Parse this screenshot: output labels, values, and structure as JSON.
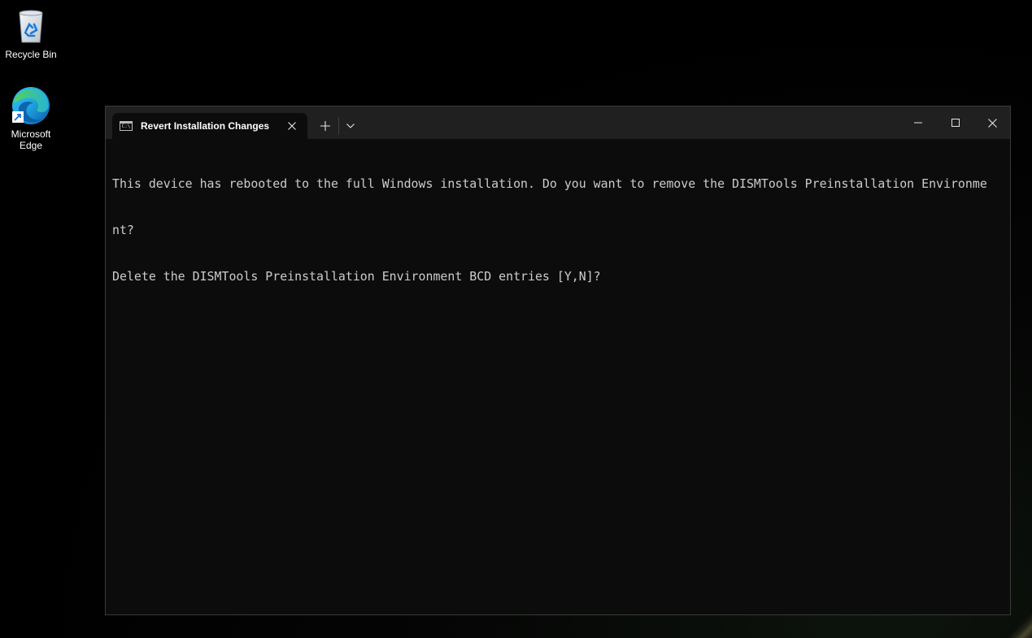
{
  "desktop": {
    "icons": [
      {
        "label": "Recycle Bin",
        "icon": "recycle-bin-icon"
      },
      {
        "label": "Microsoft\nEdge",
        "icon": "edge-icon"
      }
    ]
  },
  "window": {
    "tab": {
      "title": "Revert Installation Changes",
      "icon": "console-icon"
    },
    "buttons": {
      "new_tab": "plus-icon",
      "dropdown": "chevron-down-icon",
      "minimize": "minimize-icon",
      "maximize": "maximize-icon",
      "close": "close-icon"
    },
    "console": {
      "lines": [
        "This device has rebooted to the full Windows installation. Do you want to remove the DISMTools Preinstallation Environme",
        "nt?",
        "Delete the DISMTools Preinstallation Environment BCD entries [Y,N]?"
      ]
    }
  },
  "colors": {
    "console_bg": "#0c0c0c",
    "console_fg": "#cccccc",
    "titlebar_bg": "#202020"
  }
}
